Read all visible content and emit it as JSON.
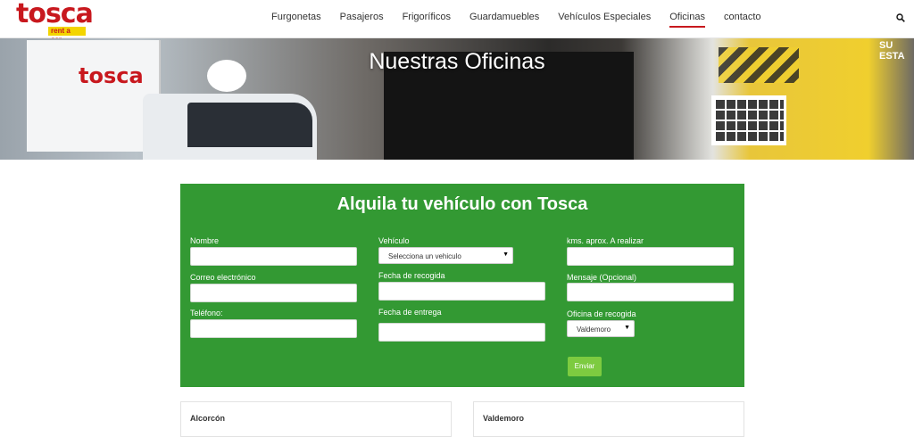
{
  "brand": {
    "name": "tosca",
    "tagline": "rent a car"
  },
  "nav": {
    "items": [
      {
        "label": "Furgonetas",
        "active": false
      },
      {
        "label": "Pasajeros",
        "active": false
      },
      {
        "label": "Frigoríficos",
        "active": false
      },
      {
        "label": "Guardamuebles",
        "active": false
      },
      {
        "label": "Vehículos Especiales",
        "active": false
      },
      {
        "label": "Oficinas",
        "active": true
      },
      {
        "label": "contacto",
        "active": false
      }
    ],
    "search_icon": "search-icon"
  },
  "hero": {
    "title": "Nuestras Oficinas",
    "truck_brand": "tosca",
    "sign_text": "SU ESTA"
  },
  "form": {
    "title": "Alquila tu vehículo con Tosca",
    "fields": {
      "name_label": "Nombre",
      "email_label": "Correo electrónico",
      "phone_label": "Teléfono:",
      "vehicle_label": "Vehículo",
      "vehicle_selected": "Selecciona un vehiculo",
      "pickup_label": "Fecha de recogida",
      "return_label": "Fecha de entrega",
      "km_label": "kms. aprox. A realizar",
      "message_label": "Mensaje (Opcional)",
      "office_label": "Oficina de recogida",
      "office_selected": "Valdemoro"
    },
    "submit_label": "Enviar"
  },
  "offices": [
    {
      "name": "Alcorcón"
    },
    {
      "name": "Valdemoro"
    }
  ],
  "colors": {
    "accent_red": "#c8181e",
    "panel_green": "#339933",
    "button_green": "#7dcb40",
    "logo_yellow": "#f3d500"
  }
}
